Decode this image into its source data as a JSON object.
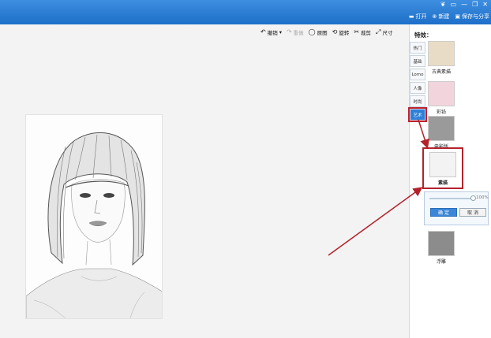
{
  "window": {
    "controls": [
      "❦",
      "▭",
      "—",
      "❐",
      "✕"
    ],
    "actions": [
      {
        "icon": "folder-icon",
        "label": "打开"
      },
      {
        "icon": "plus-circle-icon",
        "label": "新建"
      },
      {
        "icon": "save-icon",
        "label": "保存与分享"
      }
    ]
  },
  "toolbar": {
    "items": [
      {
        "icon": "undo-icon",
        "label": "撤销",
        "disabled": false
      },
      {
        "icon": "redo-icon",
        "label": "重做",
        "disabled": true
      },
      {
        "icon": "circle-icon",
        "label": "原图",
        "disabled": false
      },
      {
        "icon": "rotate-icon",
        "label": "旋转",
        "disabled": false
      },
      {
        "icon": "scissors-icon",
        "label": "裁剪",
        "disabled": false
      },
      {
        "icon": "resize-icon",
        "label": "尺寸",
        "disabled": false
      }
    ]
  },
  "panel": {
    "title": "特效：",
    "categories": [
      "热门",
      "基础",
      "Lomo",
      "人像",
      "时尚",
      "艺术"
    ],
    "active_category": "艺术",
    "effects": [
      {
        "label": "古典素描"
      },
      {
        "label": "彩铅"
      },
      {
        "label": "电影版"
      },
      {
        "label": "素描"
      },
      {
        "label": "浮雕"
      }
    ],
    "selected_effect": "素描",
    "adjust": {
      "value_percent": 100,
      "percent_label": "100%",
      "ok_label": "确 定",
      "cancel_label": "取 消"
    }
  },
  "colors": {
    "accent": "#2f7fd8",
    "highlight": "#b3222c"
  }
}
